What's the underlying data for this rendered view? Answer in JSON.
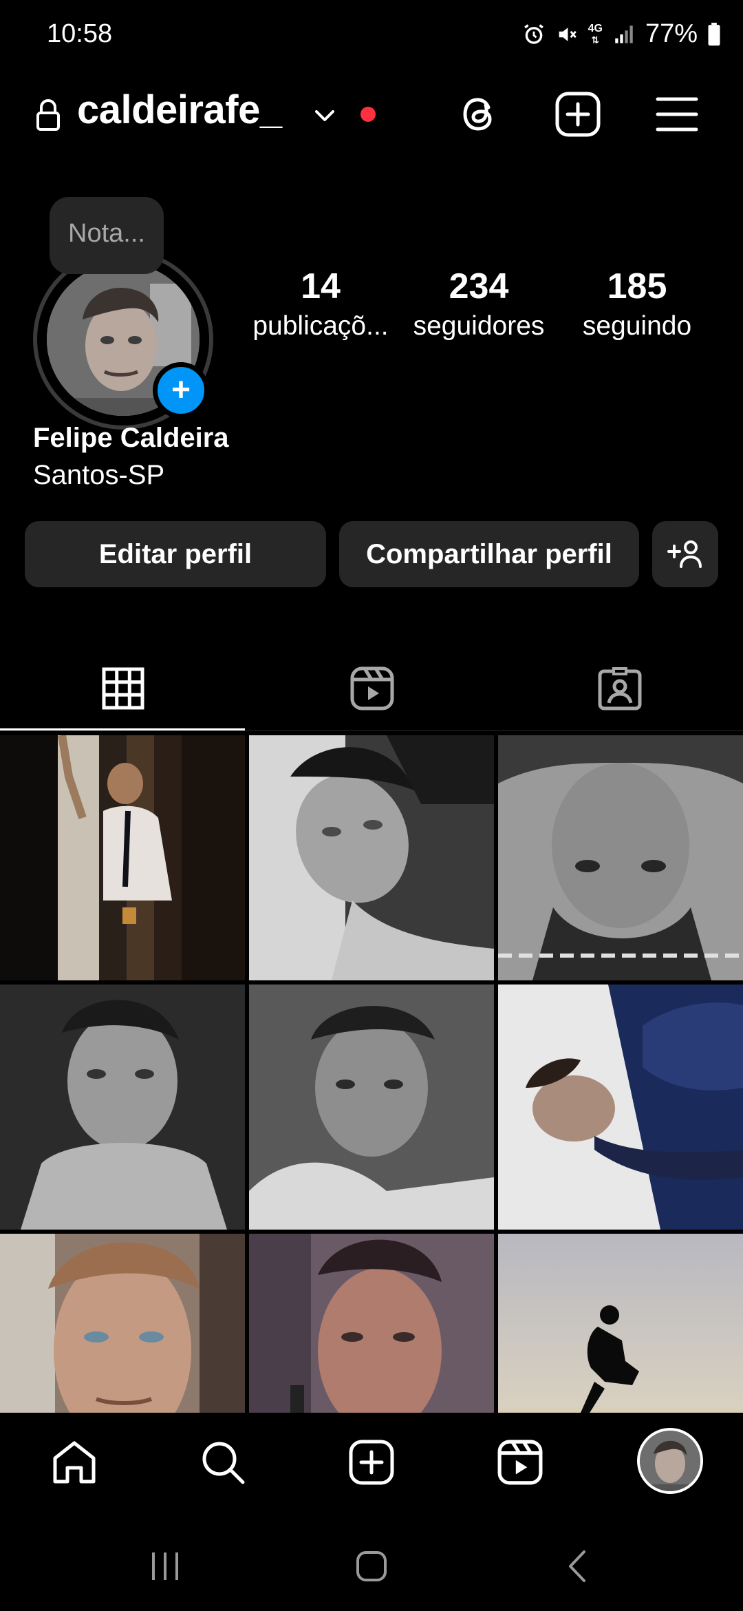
{
  "status_bar": {
    "time": "10:58",
    "network": "4G",
    "battery": "77%"
  },
  "header": {
    "username": "caldeirafe_",
    "icons": [
      "lock-icon",
      "chevron-down-icon",
      "threads-icon",
      "create-icon",
      "menu-icon"
    ],
    "notification_dot_color": "#ff3040"
  },
  "profile": {
    "note_placeholder": "Nota...",
    "name": "Felipe Caldeira",
    "location": "Santos-SP",
    "stats": {
      "posts": {
        "value": "14",
        "label": "publicaçõ..."
      },
      "followers": {
        "value": "234",
        "label": "seguidores"
      },
      "following": {
        "value": "185",
        "label": "seguindo"
      }
    }
  },
  "actions": {
    "edit_label": "Editar perfil",
    "share_label": "Compartilhar perfil",
    "add_user_icon": "add-user-icon"
  },
  "tabs": [
    {
      "name": "grid",
      "icon": "grid-icon",
      "active": true
    },
    {
      "name": "reels",
      "icon": "reels-icon",
      "active": false
    },
    {
      "name": "tagged",
      "icon": "tagged-icon",
      "active": false
    }
  ],
  "grid_posts": [
    {
      "kind": "photo",
      "subject": "man in shirt and tie at window holding glass"
    },
    {
      "kind": "photo",
      "subject": "black and white selfie lying on pillow"
    },
    {
      "kind": "photo",
      "subject": "upside-down black and white portrait"
    },
    {
      "kind": "photo",
      "subject": "black and white shirtless portrait"
    },
    {
      "kind": "photo",
      "subject": "black and white portrait in bed"
    },
    {
      "kind": "photo",
      "subject": "upside-down portrait with blue shirt"
    },
    {
      "kind": "photo",
      "subject": "color close-up portrait with light hair"
    },
    {
      "kind": "photo",
      "subject": "portrait in red light"
    },
    {
      "kind": "photo",
      "subject": "silhouette crouching at sunset"
    }
  ],
  "bottom_nav": [
    "home-icon",
    "search-icon",
    "create-icon",
    "reels-icon",
    "profile-avatar"
  ],
  "system_nav": [
    "recents-icon",
    "home-icon",
    "back-icon"
  ],
  "colors": {
    "background": "#000000",
    "button_bg": "#262626",
    "accent_blue": "#0095f6",
    "notification_red": "#ff3040"
  }
}
